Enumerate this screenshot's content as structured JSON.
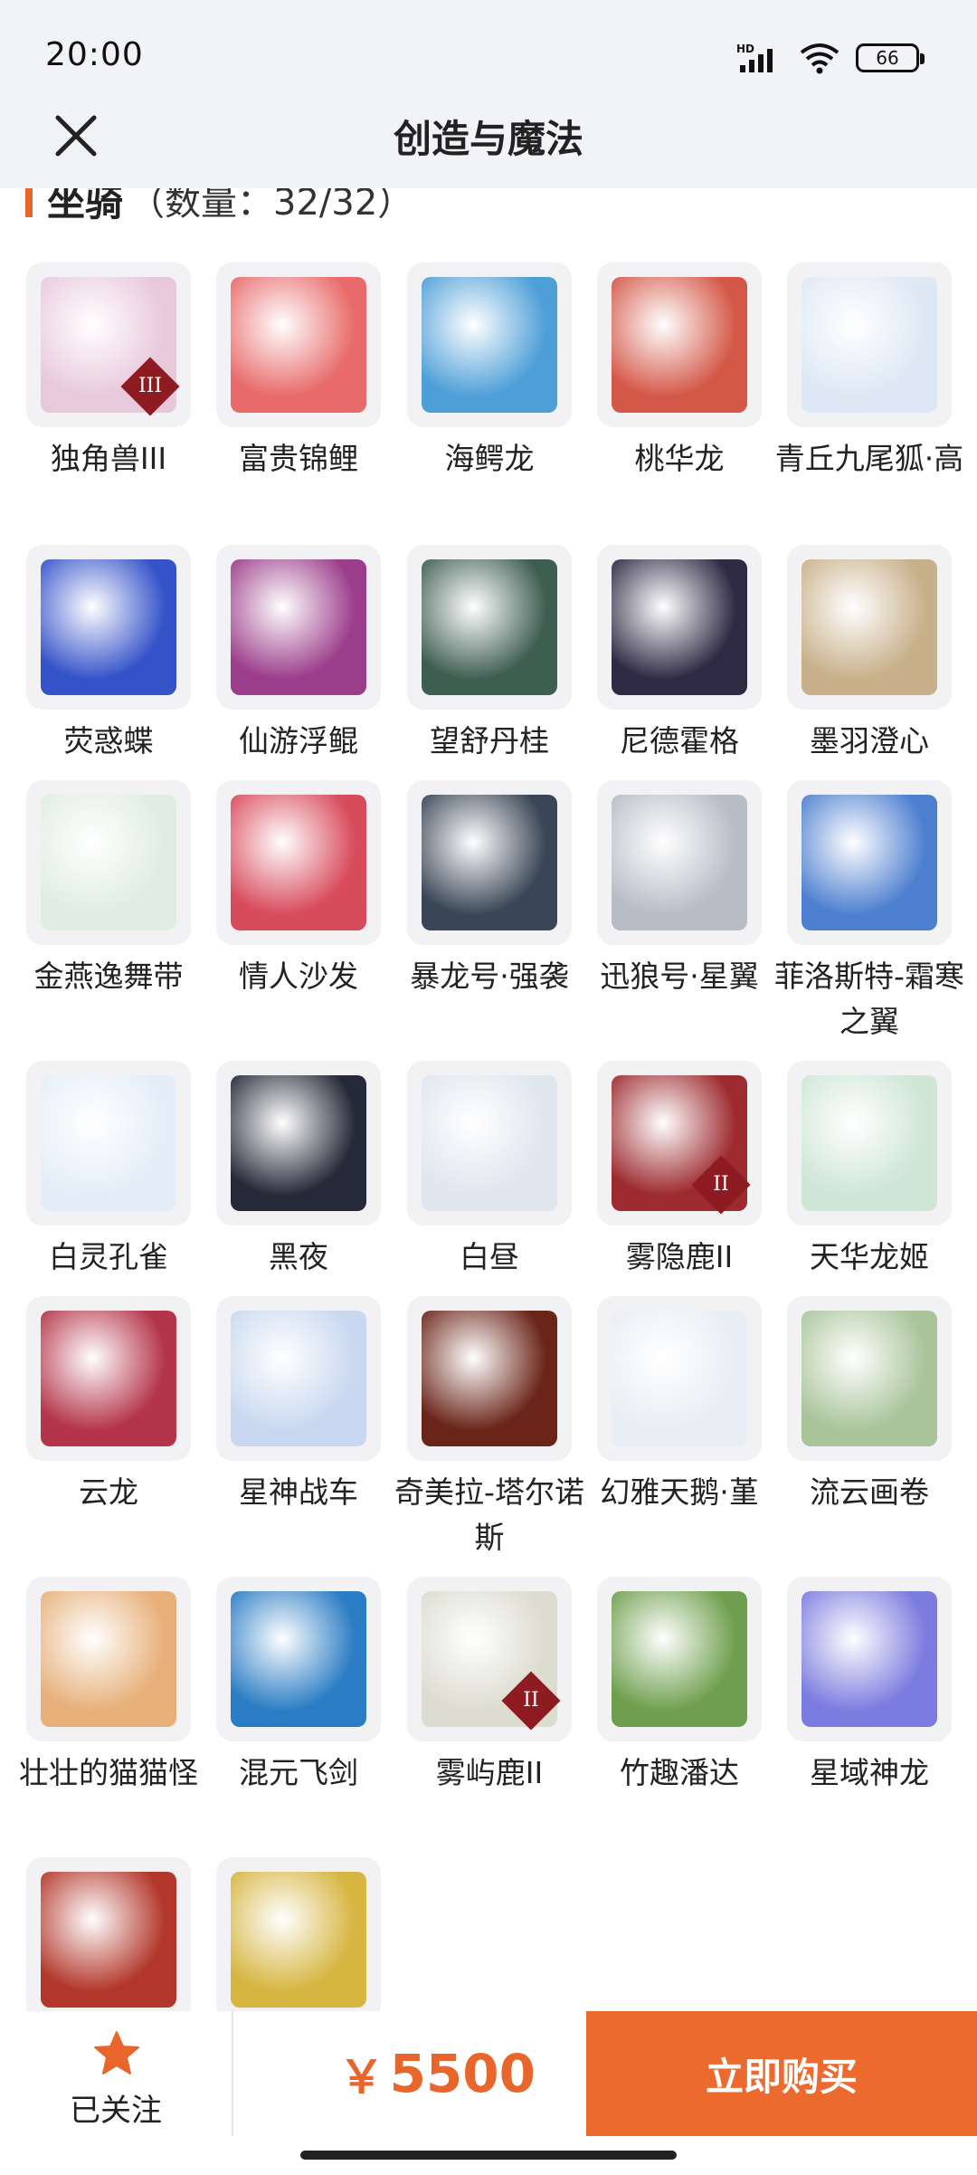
{
  "status_bar": {
    "time": "20:00",
    "battery": "66",
    "icons": [
      "hd-signal-icon",
      "wifi-icon",
      "battery-icon"
    ]
  },
  "nav": {
    "title": "创造与魔法",
    "close_icon": "close-icon"
  },
  "section": {
    "title": "坐骑",
    "count": "（数量：32/32）"
  },
  "mounts": [
    {
      "name": "独角兽III",
      "badge": "III",
      "color": "#e8c9dc"
    },
    {
      "name": "富贵锦鲤",
      "badge": "",
      "color": "#e86a6a"
    },
    {
      "name": "海鳄龙",
      "badge": "",
      "color": "#4e9fd8"
    },
    {
      "name": "桃华龙",
      "badge": "",
      "color": "#d45848"
    },
    {
      "name": "青丘九尾狐·高",
      "badge": "",
      "color": "#dde8f4"
    },
    {
      "name": "荧惑蝶",
      "badge": "",
      "color": "#3553c9"
    },
    {
      "name": "仙游浮鲲",
      "badge": "",
      "color": "#9b3d8a"
    },
    {
      "name": "望舒丹桂",
      "badge": "",
      "color": "#3f5e52"
    },
    {
      "name": "尼德霍格",
      "badge": "",
      "color": "#2e2a44"
    },
    {
      "name": "墨羽澄心",
      "badge": "",
      "color": "#c8b08a"
    },
    {
      "name": "金燕逸舞带",
      "badge": "",
      "color": "#dfeee0"
    },
    {
      "name": "情人沙发",
      "badge": "",
      "color": "#d84b5c"
    },
    {
      "name": "暴龙号·强袭",
      "badge": "",
      "color": "#3a4656"
    },
    {
      "name": "迅狼号·星翼",
      "badge": "",
      "color": "#b8bcc6"
    },
    {
      "name": "菲洛斯特-霜寒之翼",
      "badge": "",
      "color": "#4d7fd0"
    },
    {
      "name": "白灵孔雀",
      "badge": "",
      "color": "#e4eef8"
    },
    {
      "name": "黑夜",
      "badge": "",
      "color": "#262a38"
    },
    {
      "name": "白昼",
      "badge": "",
      "color": "#dfe6ee"
    },
    {
      "name": "雾隐鹿II",
      "badge": "II",
      "color": "#9c2a2e"
    },
    {
      "name": "天华龙姬",
      "badge": "",
      "color": "#cfe6d6"
    },
    {
      "name": "云龙",
      "badge": "",
      "color": "#b4344a"
    },
    {
      "name": "星神战车",
      "badge": "",
      "color": "#c9d8f0"
    },
    {
      "name": "奇美拉-塔尔诺斯",
      "badge": "",
      "color": "#6a2418"
    },
    {
      "name": "幻雅天鹅·堇",
      "badge": "",
      "color": "#e9eef4"
    },
    {
      "name": "流云画卷",
      "badge": "",
      "color": "#a9c49a"
    },
    {
      "name": "壮壮的猫猫怪",
      "badge": "",
      "color": "#e7b07a"
    },
    {
      "name": "混元飞剑",
      "badge": "",
      "color": "#2a7cc4"
    },
    {
      "name": "雾屿鹿II",
      "badge": "II",
      "color": "#dcdcd0"
    },
    {
      "name": "竹趣潘达",
      "badge": "",
      "color": "#6f9f4e"
    },
    {
      "name": "星域神龙",
      "badge": "",
      "color": "#7c7ce0"
    },
    {
      "name": "",
      "badge": "",
      "color": "#b2362a"
    },
    {
      "name": "",
      "badge": "",
      "color": "#d6b540"
    }
  ],
  "bottom_bar": {
    "follow_label": "已关注",
    "follow_icon": "star-icon",
    "price_symbol": "￥",
    "price_value": "5500",
    "buy_label": "立即购买",
    "accent": "#ec6a2e"
  }
}
